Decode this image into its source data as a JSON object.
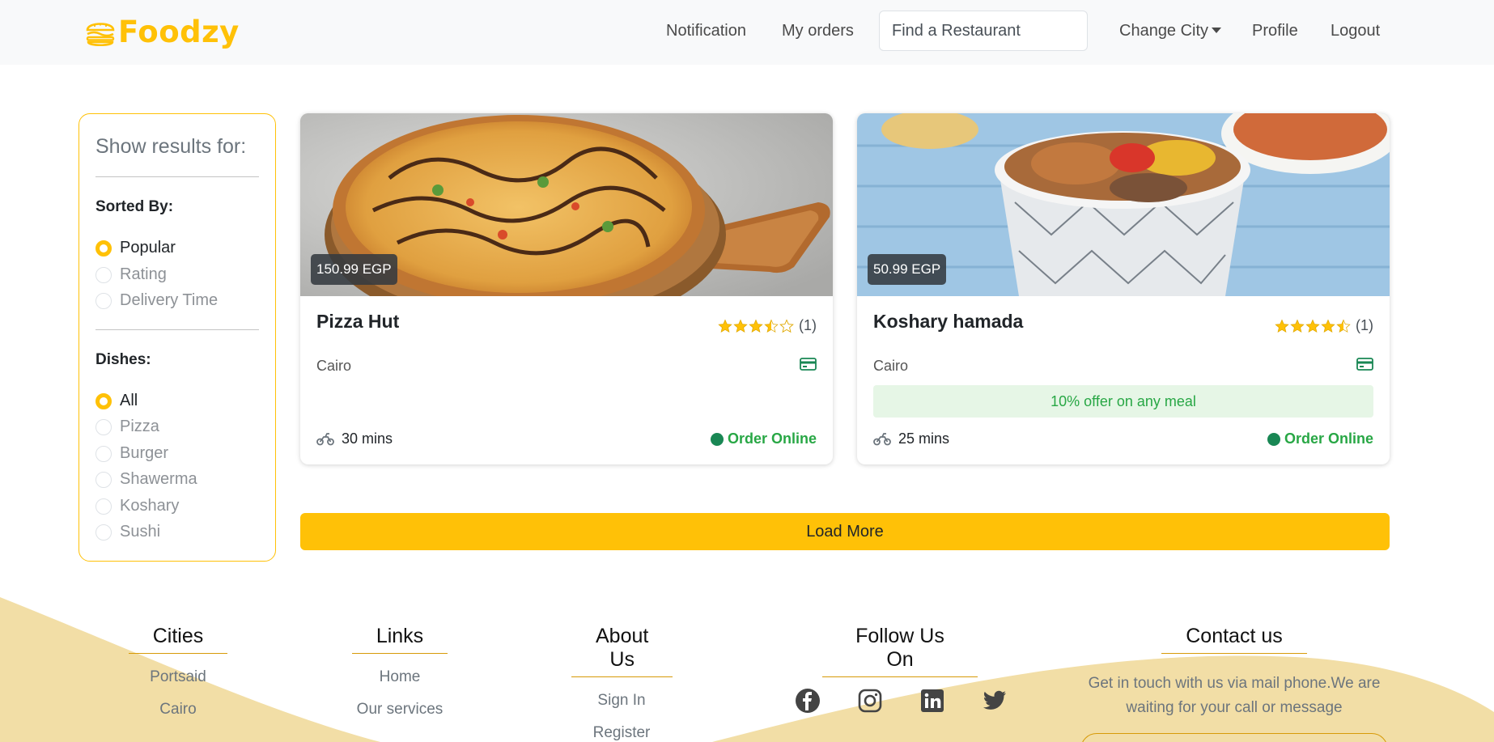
{
  "brand": {
    "name": "Foodzy",
    "logo_icon": "burger-icon",
    "color": "#ffc107"
  },
  "nav": {
    "notification": "Notification",
    "my_orders": "My orders",
    "search_placeholder": "Find a Restaurant",
    "change_city": "Change City",
    "profile": "Profile",
    "logout": "Logout"
  },
  "sidebar": {
    "title": "Show results for:",
    "sorted_by": {
      "label": "Sorted By:",
      "options": [
        {
          "label": "Popular",
          "checked": true
        },
        {
          "label": "Rating",
          "checked": false
        },
        {
          "label": "Delivery Time",
          "checked": false
        }
      ]
    },
    "dishes": {
      "label": "Dishes:",
      "options": [
        {
          "label": "All",
          "checked": true
        },
        {
          "label": "Pizza",
          "checked": false
        },
        {
          "label": "Burger",
          "checked": false
        },
        {
          "label": "Shawerma",
          "checked": false
        },
        {
          "label": "Koshary",
          "checked": false
        },
        {
          "label": "Sushi",
          "checked": false
        }
      ]
    }
  },
  "restaurants": [
    {
      "name": "Pizza Hut",
      "price": "150.99 EGP",
      "rating": 3.5,
      "rating_count": "(1)",
      "city": "Cairo",
      "offer": "",
      "delivery_time": "30 mins",
      "order_label": "Order Online",
      "image": "pizza on wooden board"
    },
    {
      "name": "Koshary hamada",
      "price": "50.99 EGP",
      "rating": 4.5,
      "rating_count": "(1)",
      "city": "Cairo",
      "offer": "10% offer on any meal",
      "delivery_time": "25 mins",
      "order_label": "Order Online",
      "image": "koshary cup"
    }
  ],
  "load_more": "Load More",
  "footer": {
    "cities": {
      "title": "Cities",
      "links": [
        "Portsaid",
        "Cairo"
      ]
    },
    "links": {
      "title": "Links",
      "links": [
        "Home",
        "Our services"
      ]
    },
    "about": {
      "title": "About Us",
      "links": [
        "Sign In",
        "Register"
      ]
    },
    "follow": {
      "title": "Follow Us On",
      "icons": [
        "facebook-icon",
        "instagram-icon",
        "linkedin-icon",
        "twitter-icon"
      ]
    },
    "contact": {
      "title": "Contact us",
      "text": "Get in touch with us via mail phone.We are waiting for your call or message"
    }
  },
  "colors": {
    "accent": "#ffc107",
    "success": "#28a745",
    "footer_wave": "#f2dea6"
  }
}
